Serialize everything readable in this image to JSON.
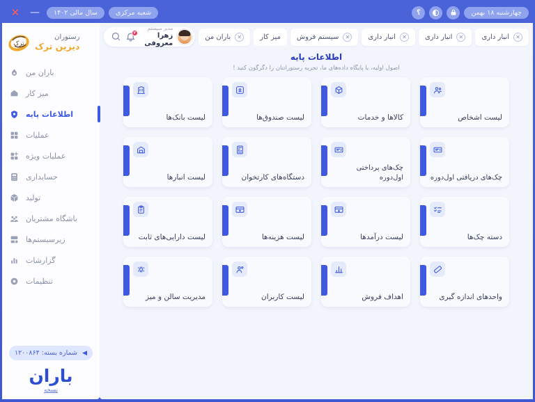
{
  "titlebar": {
    "date": "چهارشنبه ۱۸ بهمن",
    "lock_icon": "lock-icon",
    "theme_icon": "theme-toggle-icon",
    "help_icon": "help-icon",
    "branch": "شعبه مرکزی",
    "fiscal_year": "سال مالی ۱۴۰۲",
    "minimize": "—",
    "close": "✕"
  },
  "sidebar": {
    "brand_line1": "رستوران",
    "brand_line2": "دیزین ترک",
    "items": [
      {
        "label": "باران من",
        "icon": "droplet-icon",
        "active": false
      },
      {
        "label": "میز کار",
        "icon": "desk-icon",
        "active": false
      },
      {
        "label": "اطلاعات پایه",
        "icon": "shield-icon",
        "active": true
      },
      {
        "label": "عملیات",
        "icon": "grid-icon",
        "active": false
      },
      {
        "label": "عملیات ویژه",
        "icon": "grid-plus-icon",
        "active": false
      },
      {
        "label": "حسابداری",
        "icon": "calculator-icon",
        "active": false
      },
      {
        "label": "تولید",
        "icon": "box-icon",
        "active": false
      },
      {
        "label": "باشگاه مشتریان",
        "icon": "people-icon",
        "active": false
      },
      {
        "label": "زیرسیستم‌ها",
        "icon": "subsystems-icon",
        "active": false
      },
      {
        "label": "گزارشات",
        "icon": "bar-chart-icon",
        "active": false
      },
      {
        "label": "تنظیمات",
        "icon": "gear-icon",
        "active": false
      }
    ],
    "package_label": "شماره بسته: ۱۲۰۰۸۶۴",
    "package_arrow": "◀",
    "baran_logo_text": "باران",
    "version_link": "نسخه"
  },
  "toolbar": {
    "user_role": "مدیر سیستم",
    "user_name": "زهرا معروفی",
    "bell_badge": "۲",
    "search_icon": "search-icon",
    "bell_icon": "bell-icon",
    "tabs": [
      {
        "label": "باران من",
        "closable": true
      },
      {
        "label": "میز کار",
        "closable": false
      },
      {
        "label": "سیستم فروش",
        "closable": true
      },
      {
        "label": "انبار داری",
        "closable": true
      },
      {
        "label": "انبار داری",
        "closable": true
      },
      {
        "label": "انبار داری",
        "closable": true
      }
    ]
  },
  "page": {
    "title": "اطلاعات پایه",
    "subtitle": "اصول اولیه، با پایگاه داده‌های ما، تجربه رستورانتان را دگرگون کنید !"
  },
  "cards": [
    {
      "label": "لیست اشخاص",
      "icon": "people-group-icon"
    },
    {
      "label": "کالاها و خدمات",
      "icon": "box-3d-icon"
    },
    {
      "label": "لیست صندوق‌ها",
      "icon": "cashbox-icon"
    },
    {
      "label": "لیست بانک‌ها",
      "icon": "bank-icon"
    },
    {
      "label": "چک‌های دریافتی اول‌دوره",
      "icon": "cheque-in-icon"
    },
    {
      "label": "چک‌های پرداختی اول‌دوره",
      "icon": "cheque-out-icon"
    },
    {
      "label": "دستگاه‌های کارتخوان",
      "icon": "pos-terminal-icon"
    },
    {
      "label": "لیست انبارها",
      "icon": "warehouse-icon"
    },
    {
      "label": "دسته چک‌ها",
      "icon": "checklist-icon"
    },
    {
      "label": "لیست درآمدها",
      "icon": "income-card-icon"
    },
    {
      "label": "لیست هزینه‌ها",
      "icon": "expense-card-icon"
    },
    {
      "label": "لیست دارایی‌های ثابت",
      "icon": "clipboard-icon"
    },
    {
      "label": "واحدهای اندازه گیری",
      "icon": "ruler-icon"
    },
    {
      "label": "اهداف فروش",
      "icon": "bar-chart-icon"
    },
    {
      "label": "لیست کاربران",
      "icon": "users-icon"
    },
    {
      "label": "مدیریت سالن و میز",
      "icon": "table-layout-icon"
    }
  ],
  "colors": {
    "accent": "#3f5ae0",
    "brand_gold": "#f0a92c",
    "badge_red": "#f2335b",
    "window_bg": "#4a63d8",
    "main_bg": "#f3f5fc"
  }
}
